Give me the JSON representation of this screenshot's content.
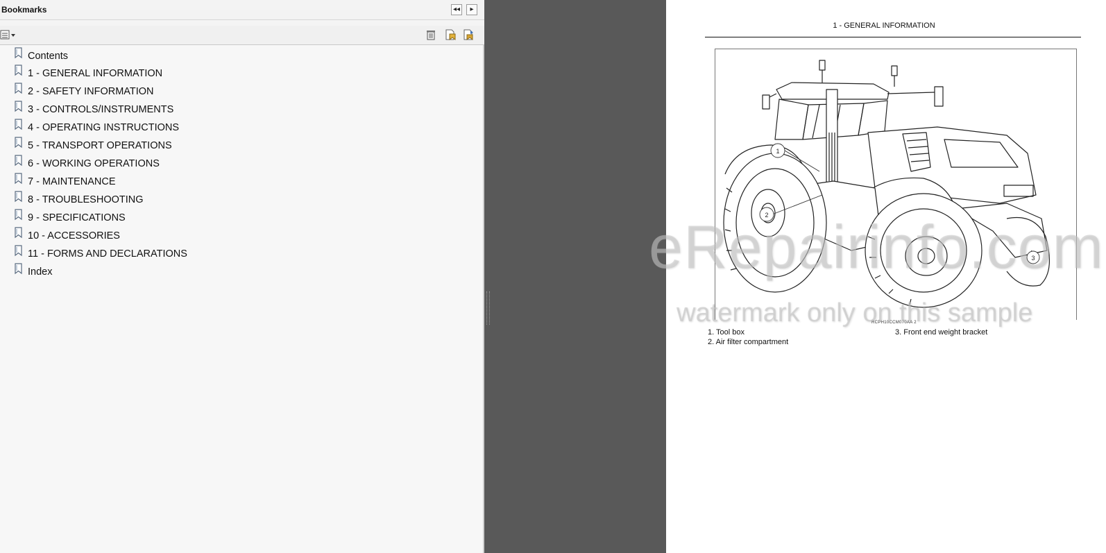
{
  "bookmarks_panel": {
    "title": "Bookmarks",
    "header_buttons": {
      "collapse": "◂◂",
      "expand": "▸"
    },
    "toolbar": [
      "options-icon",
      "delete-icon",
      "new-bookmark-icon",
      "expand-bookmark-icon"
    ],
    "items": [
      {
        "label": "Contents"
      },
      {
        "label": "1 - GENERAL INFORMATION"
      },
      {
        "label": "2 - SAFETY INFORMATION"
      },
      {
        "label": "3 - CONTROLS/INSTRUMENTS"
      },
      {
        "label": "4 - OPERATING INSTRUCTIONS"
      },
      {
        "label": "5 - TRANSPORT OPERATIONS"
      },
      {
        "label": "6 - WORKING OPERATIONS"
      },
      {
        "label": "7 - MAINTENANCE"
      },
      {
        "label": "8 - TROUBLESHOOTING"
      },
      {
        "label": "9 - SPECIFICATIONS"
      },
      {
        "label": "10 - ACCESSORIES"
      },
      {
        "label": "11 - FORMS AND DECLARATIONS"
      },
      {
        "label": "Index"
      }
    ]
  },
  "document": {
    "section_title": "1 - GENERAL INFORMATION",
    "figure_code": "RCPH10CCM070AA   2",
    "callouts": [
      "1",
      "2",
      "3"
    ],
    "legend": [
      {
        "number": "1.",
        "text": "Tool box"
      },
      {
        "number": "2.",
        "text": "Air filter compartment"
      },
      {
        "number": "3.",
        "text": "Front end weight bracket"
      }
    ]
  },
  "watermark": {
    "line1": "eRepairinfo.com",
    "line2": "watermark only on this sample"
  },
  "colors": {
    "panel_bg": "#f7f7f7",
    "gutter": "#595959",
    "page_bg": "#ffffff"
  }
}
